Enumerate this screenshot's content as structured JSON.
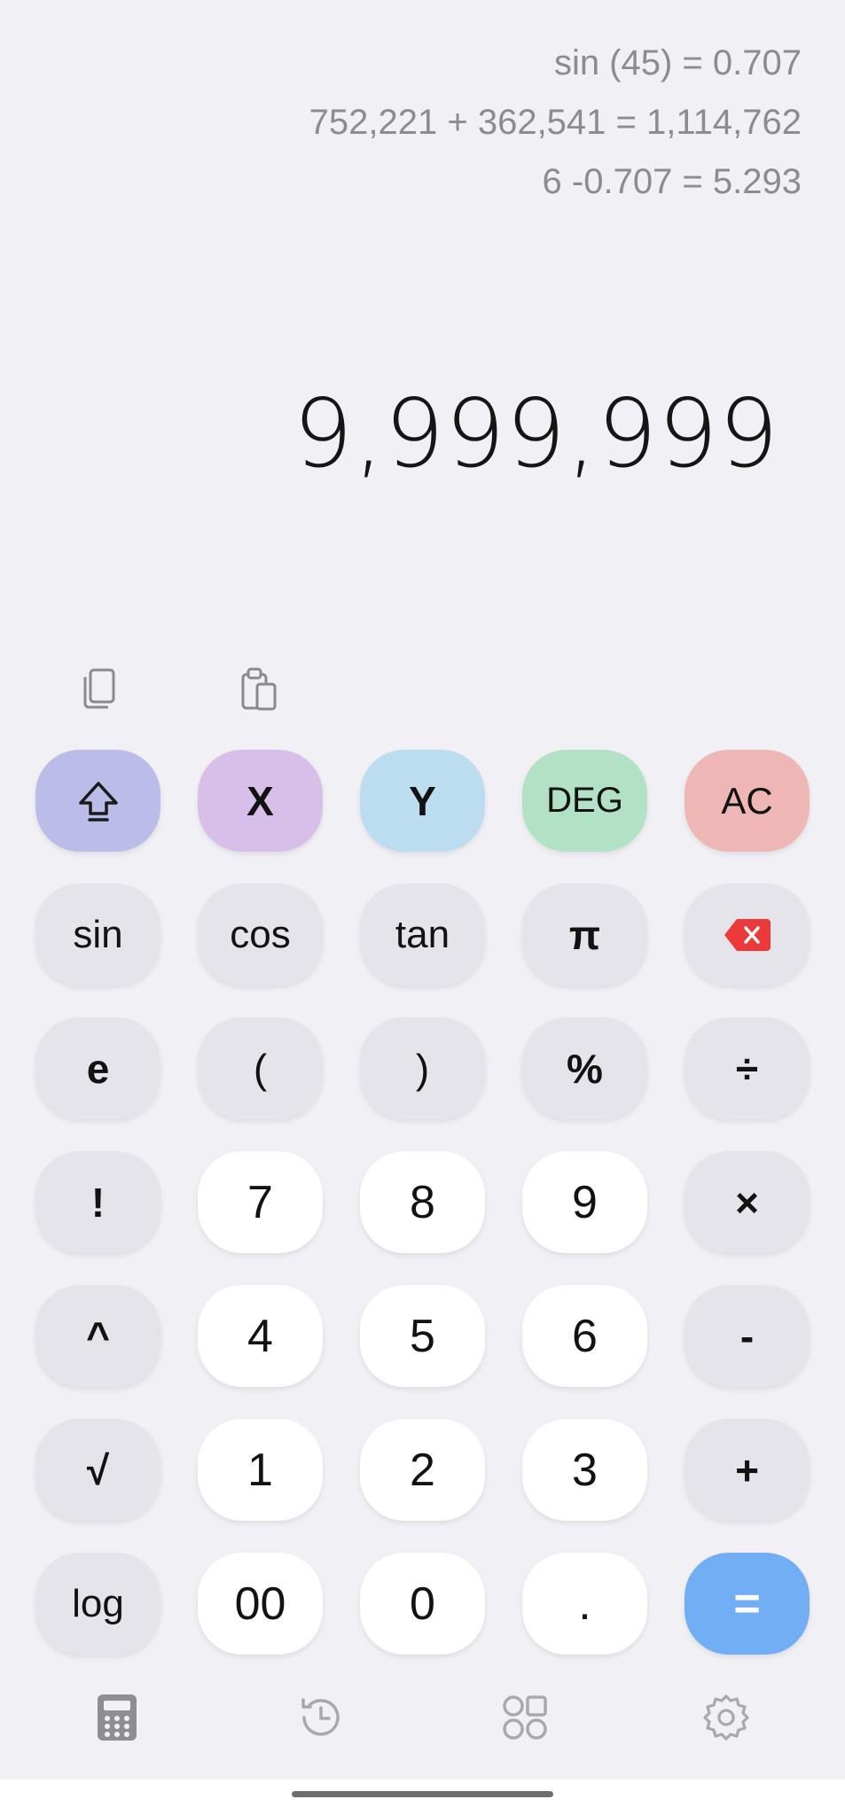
{
  "history": [
    "sin (45) = 0.707",
    "752,221 + 362,541 = 1,114,762",
    "6 -0.707 = 5.293"
  ],
  "display": "9,999,999",
  "utility": {
    "copy_icon": "copy-icon",
    "paste_icon": "paste-icon"
  },
  "keys": {
    "row1": [
      "⇧",
      "X",
      "Y",
      "DEG",
      "AC"
    ],
    "row2": [
      "sin",
      "cos",
      "tan",
      "π",
      "⌫"
    ],
    "row3": [
      "e",
      "(",
      ")",
      "%",
      "÷"
    ],
    "row4": [
      "!",
      "7",
      "8",
      "9",
      "×"
    ],
    "row5": [
      "^",
      "4",
      "5",
      "6",
      "-"
    ],
    "row6": [
      "√",
      "1",
      "2",
      "3",
      "+"
    ],
    "row7": [
      "log",
      "00",
      "0",
      ".",
      "="
    ]
  },
  "nav": {
    "items": [
      "calculator-icon",
      "history-icon",
      "shapes-icon",
      "settings-icon"
    ]
  },
  "colors": {
    "background": "#f1f0f5",
    "shift": "#bcbce8",
    "x": "#d8bfea",
    "y": "#bcdcf0",
    "deg": "#b2e1c5",
    "ac": "#efb6b6",
    "equals": "#72aef4",
    "backspace": "#ec3a3a"
  }
}
